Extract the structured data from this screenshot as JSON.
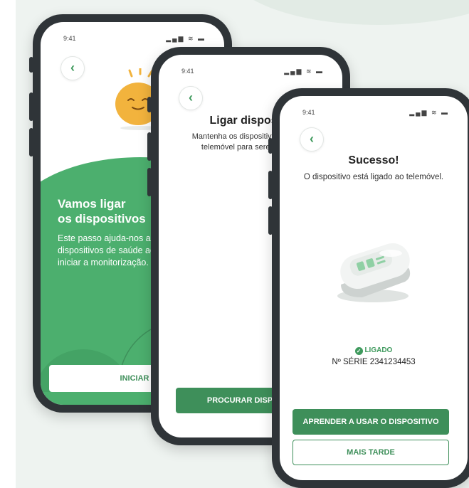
{
  "status_time": "9:41",
  "status_icons": "▂▄▆ ≋ ▬",
  "screen1": {
    "heading_line1": "Vamos ligar",
    "heading_line2": "os dispositivos",
    "body": "Este passo ajuda-nos a ligar os dispositivos de saúde ao telemóvel, para iniciar a monitorização.",
    "button": "INICIAR"
  },
  "screen2": {
    "title": "Ligar dispositivos",
    "subtitle": "Mantenha os dispositivos próximos do telemóvel para serem detetados.",
    "button": "PROCURAR DISPOSITIVOS"
  },
  "screen3": {
    "title": "Sucesso!",
    "subtitle": "O dispositivo está ligado ao telemóvel.",
    "status_label": "LIGADO",
    "serial": "Nº SÉRIE 2341234453",
    "primary_button": "APRENDER A USAR O DISPOSITIVO",
    "secondary_button": "MAIS TARDE"
  },
  "colors": {
    "brand_green": "#3e8f5a",
    "light_green": "#4caf6e",
    "status_green": "#3f9a5d"
  }
}
